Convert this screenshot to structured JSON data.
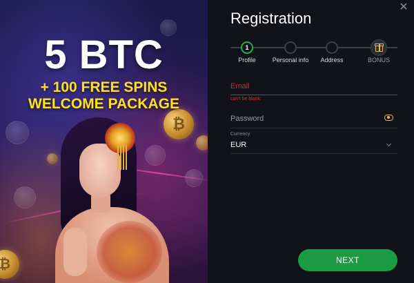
{
  "promo": {
    "headline": "5 BTC",
    "line1": "+ 100 FREE SPINS",
    "line2": "WELCOME PACKAGE"
  },
  "registration": {
    "title": "Registration",
    "close_icon": "close-icon",
    "steps": [
      {
        "label": "Profile",
        "number": "1",
        "state": "active"
      },
      {
        "label": "Personal info",
        "number": "",
        "state": "pending"
      },
      {
        "label": "Address",
        "number": "",
        "state": "pending"
      },
      {
        "label": "BONUS",
        "icon": "gift-icon",
        "state": "bonus"
      }
    ],
    "email": {
      "placeholder": "Email",
      "value": "",
      "error": "can't be blank"
    },
    "password": {
      "placeholder": "Password",
      "value": "",
      "toggle_icon": "eye-icon"
    },
    "currency": {
      "label": "Currency",
      "value": "EUR",
      "icon": "chevron-down-icon"
    },
    "next_button": "NEXT"
  },
  "colors": {
    "accent_green": "#1c9b45",
    "error_red": "#c7242c",
    "headline_yellow": "#ffe21f",
    "icon_gold": "#e8b563",
    "panel_bg": "#121319"
  }
}
